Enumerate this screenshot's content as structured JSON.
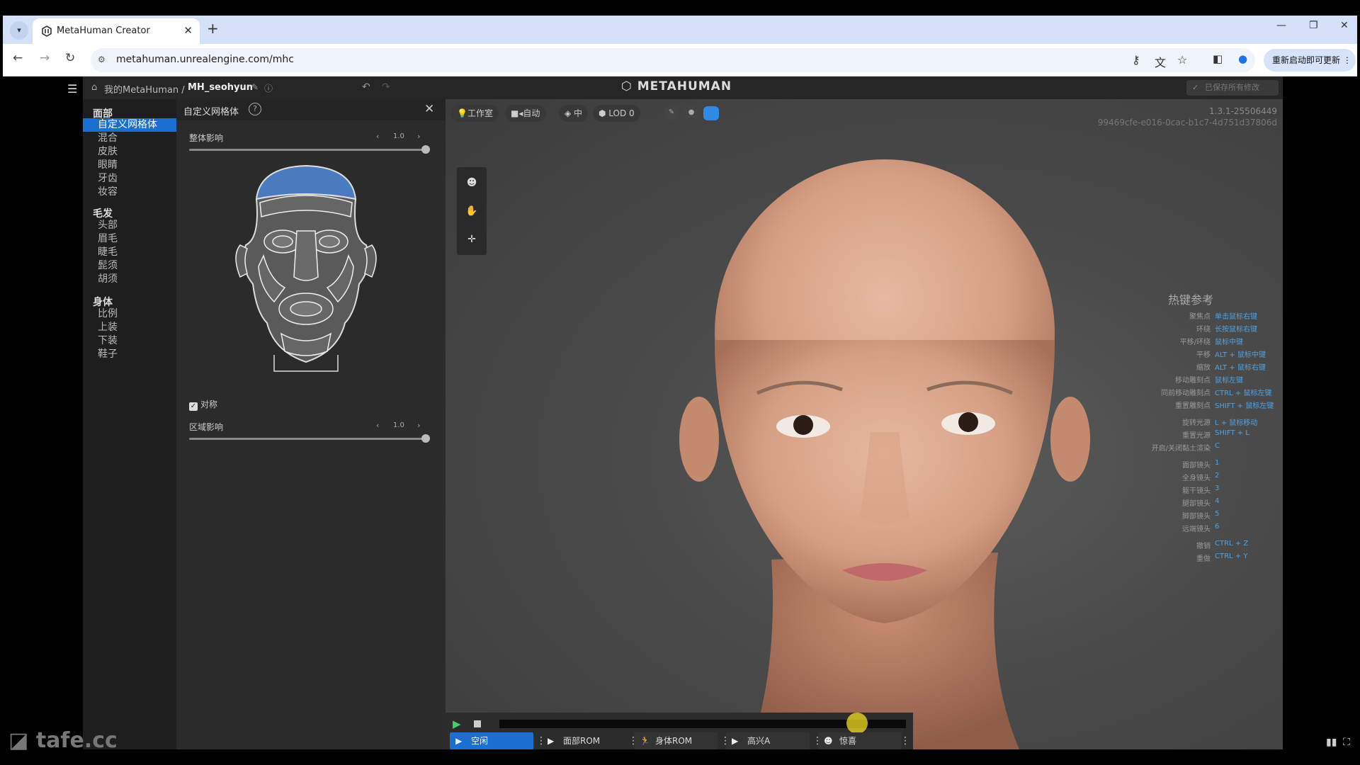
{
  "browser": {
    "tab_title": "MetaHuman Creator",
    "url": "metahuman.unrealengine.com/mhc",
    "update_label": "重新启动即可更新"
  },
  "app": {
    "breadcrumb_root": "我的MetaHuman /",
    "breadcrumb_name": "MH_seohyun",
    "logo": "METAHUMAN",
    "saved_label": "已保存所有修改"
  },
  "sidenav": {
    "sections": [
      {
        "title": "面部",
        "items": [
          "自定义网格体",
          "混合",
          "皮肤",
          "眼睛",
          "牙齿",
          "妆容"
        ]
      },
      {
        "title": "毛发",
        "items": [
          "头部",
          "眉毛",
          "睫毛",
          "髭须",
          "胡须"
        ]
      },
      {
        "title": "身体",
        "items": [
          "比例",
          "上装",
          "下装",
          "鞋子"
        ]
      }
    ],
    "active_item": "自定义网格体"
  },
  "panel": {
    "title": "自定义网格体",
    "global_label": "整体影响",
    "global_value": "1.0",
    "global_level": 1.0,
    "symmetry_label": "对称",
    "symmetry_checked": true,
    "region_label": "区域影响",
    "region_value": "1.0",
    "region_level": 1.0
  },
  "viewport": {
    "chips": [
      "工作室",
      "自动",
      "中",
      "LOD 0"
    ],
    "build_version": "1.3.1-25506449",
    "build_id": "99469cfe-e016-0cac-b1c7-4d751d37806d",
    "hotkeys_title": "热键参考",
    "hotkeys": [
      [
        "聚焦点",
        "单击鼠标右键"
      ],
      [
        "环绕",
        "长按鼠标右键"
      ],
      [
        "平移/环绕",
        "鼠标中键"
      ],
      [
        "平移",
        "ALT + 鼠标中键"
      ],
      [
        "缩放",
        "ALT + 鼠标右键"
      ],
      [
        "移动雕刻点",
        "鼠标左键"
      ],
      [
        "同前移动雕刻点",
        "CTRL + 鼠标左键"
      ],
      [
        "重置雕刻点",
        "SHIFT + 鼠标左键"
      ],
      [
        "旋转光源",
        "L + 鼠标移动"
      ],
      [
        "重置光源",
        "SHIFT + L"
      ],
      [
        "开启/关闭黏土渲染",
        "C"
      ],
      [
        "面部镜头",
        "1"
      ],
      [
        "全身镜头",
        "2"
      ],
      [
        "躯干镜头",
        "3"
      ],
      [
        "腿部镜头",
        "4"
      ],
      [
        "脚部镜头",
        "5"
      ],
      [
        "远端镜头",
        "6"
      ],
      [
        "撤销",
        "CTRL + Z"
      ],
      [
        "重做",
        "CTRL + Y"
      ]
    ]
  },
  "playback": {
    "progress": 0.88,
    "animations": [
      "空闲",
      "面部ROM",
      "身体ROM",
      "高兴A",
      "惊喜"
    ],
    "active_animation": "空闲"
  },
  "watermark": "tafe.cc",
  "colors": {
    "accent": "#1a6fd1",
    "hotkey": "#4aa3e8",
    "play": "#3fd06a"
  }
}
